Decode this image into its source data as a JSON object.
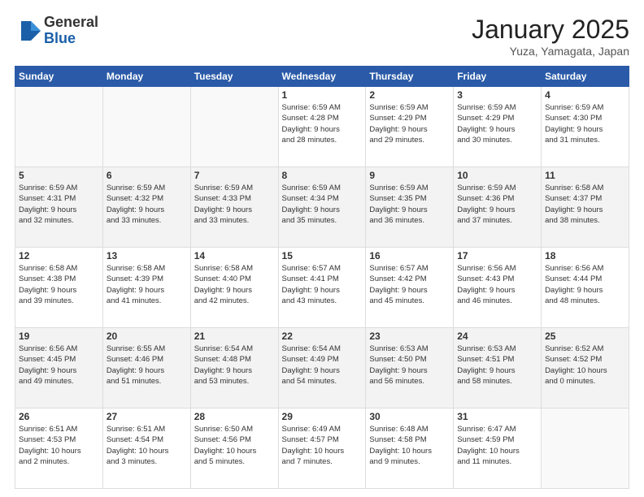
{
  "logo": {
    "general": "General",
    "blue": "Blue"
  },
  "header": {
    "month": "January 2025",
    "location": "Yuza, Yamagata, Japan"
  },
  "weekdays": [
    "Sunday",
    "Monday",
    "Tuesday",
    "Wednesday",
    "Thursday",
    "Friday",
    "Saturday"
  ],
  "weeks": [
    {
      "alt": false,
      "days": [
        {
          "num": "",
          "info": ""
        },
        {
          "num": "",
          "info": ""
        },
        {
          "num": "",
          "info": ""
        },
        {
          "num": "1",
          "info": "Sunrise: 6:59 AM\nSunset: 4:28 PM\nDaylight: 9 hours\nand 28 minutes."
        },
        {
          "num": "2",
          "info": "Sunrise: 6:59 AM\nSunset: 4:29 PM\nDaylight: 9 hours\nand 29 minutes."
        },
        {
          "num": "3",
          "info": "Sunrise: 6:59 AM\nSunset: 4:29 PM\nDaylight: 9 hours\nand 30 minutes."
        },
        {
          "num": "4",
          "info": "Sunrise: 6:59 AM\nSunset: 4:30 PM\nDaylight: 9 hours\nand 31 minutes."
        }
      ]
    },
    {
      "alt": true,
      "days": [
        {
          "num": "5",
          "info": "Sunrise: 6:59 AM\nSunset: 4:31 PM\nDaylight: 9 hours\nand 32 minutes."
        },
        {
          "num": "6",
          "info": "Sunrise: 6:59 AM\nSunset: 4:32 PM\nDaylight: 9 hours\nand 33 minutes."
        },
        {
          "num": "7",
          "info": "Sunrise: 6:59 AM\nSunset: 4:33 PM\nDaylight: 9 hours\nand 33 minutes."
        },
        {
          "num": "8",
          "info": "Sunrise: 6:59 AM\nSunset: 4:34 PM\nDaylight: 9 hours\nand 35 minutes."
        },
        {
          "num": "9",
          "info": "Sunrise: 6:59 AM\nSunset: 4:35 PM\nDaylight: 9 hours\nand 36 minutes."
        },
        {
          "num": "10",
          "info": "Sunrise: 6:59 AM\nSunset: 4:36 PM\nDaylight: 9 hours\nand 37 minutes."
        },
        {
          "num": "11",
          "info": "Sunrise: 6:58 AM\nSunset: 4:37 PM\nDaylight: 9 hours\nand 38 minutes."
        }
      ]
    },
    {
      "alt": false,
      "days": [
        {
          "num": "12",
          "info": "Sunrise: 6:58 AM\nSunset: 4:38 PM\nDaylight: 9 hours\nand 39 minutes."
        },
        {
          "num": "13",
          "info": "Sunrise: 6:58 AM\nSunset: 4:39 PM\nDaylight: 9 hours\nand 41 minutes."
        },
        {
          "num": "14",
          "info": "Sunrise: 6:58 AM\nSunset: 4:40 PM\nDaylight: 9 hours\nand 42 minutes."
        },
        {
          "num": "15",
          "info": "Sunrise: 6:57 AM\nSunset: 4:41 PM\nDaylight: 9 hours\nand 43 minutes."
        },
        {
          "num": "16",
          "info": "Sunrise: 6:57 AM\nSunset: 4:42 PM\nDaylight: 9 hours\nand 45 minutes."
        },
        {
          "num": "17",
          "info": "Sunrise: 6:56 AM\nSunset: 4:43 PM\nDaylight: 9 hours\nand 46 minutes."
        },
        {
          "num": "18",
          "info": "Sunrise: 6:56 AM\nSunset: 4:44 PM\nDaylight: 9 hours\nand 48 minutes."
        }
      ]
    },
    {
      "alt": true,
      "days": [
        {
          "num": "19",
          "info": "Sunrise: 6:56 AM\nSunset: 4:45 PM\nDaylight: 9 hours\nand 49 minutes."
        },
        {
          "num": "20",
          "info": "Sunrise: 6:55 AM\nSunset: 4:46 PM\nDaylight: 9 hours\nand 51 minutes."
        },
        {
          "num": "21",
          "info": "Sunrise: 6:54 AM\nSunset: 4:48 PM\nDaylight: 9 hours\nand 53 minutes."
        },
        {
          "num": "22",
          "info": "Sunrise: 6:54 AM\nSunset: 4:49 PM\nDaylight: 9 hours\nand 54 minutes."
        },
        {
          "num": "23",
          "info": "Sunrise: 6:53 AM\nSunset: 4:50 PM\nDaylight: 9 hours\nand 56 minutes."
        },
        {
          "num": "24",
          "info": "Sunrise: 6:53 AM\nSunset: 4:51 PM\nDaylight: 9 hours\nand 58 minutes."
        },
        {
          "num": "25",
          "info": "Sunrise: 6:52 AM\nSunset: 4:52 PM\nDaylight: 10 hours\nand 0 minutes."
        }
      ]
    },
    {
      "alt": false,
      "days": [
        {
          "num": "26",
          "info": "Sunrise: 6:51 AM\nSunset: 4:53 PM\nDaylight: 10 hours\nand 2 minutes."
        },
        {
          "num": "27",
          "info": "Sunrise: 6:51 AM\nSunset: 4:54 PM\nDaylight: 10 hours\nand 3 minutes."
        },
        {
          "num": "28",
          "info": "Sunrise: 6:50 AM\nSunset: 4:56 PM\nDaylight: 10 hours\nand 5 minutes."
        },
        {
          "num": "29",
          "info": "Sunrise: 6:49 AM\nSunset: 4:57 PM\nDaylight: 10 hours\nand 7 minutes."
        },
        {
          "num": "30",
          "info": "Sunrise: 6:48 AM\nSunset: 4:58 PM\nDaylight: 10 hours\nand 9 minutes."
        },
        {
          "num": "31",
          "info": "Sunrise: 6:47 AM\nSunset: 4:59 PM\nDaylight: 10 hours\nand 11 minutes."
        },
        {
          "num": "",
          "info": ""
        }
      ]
    }
  ]
}
